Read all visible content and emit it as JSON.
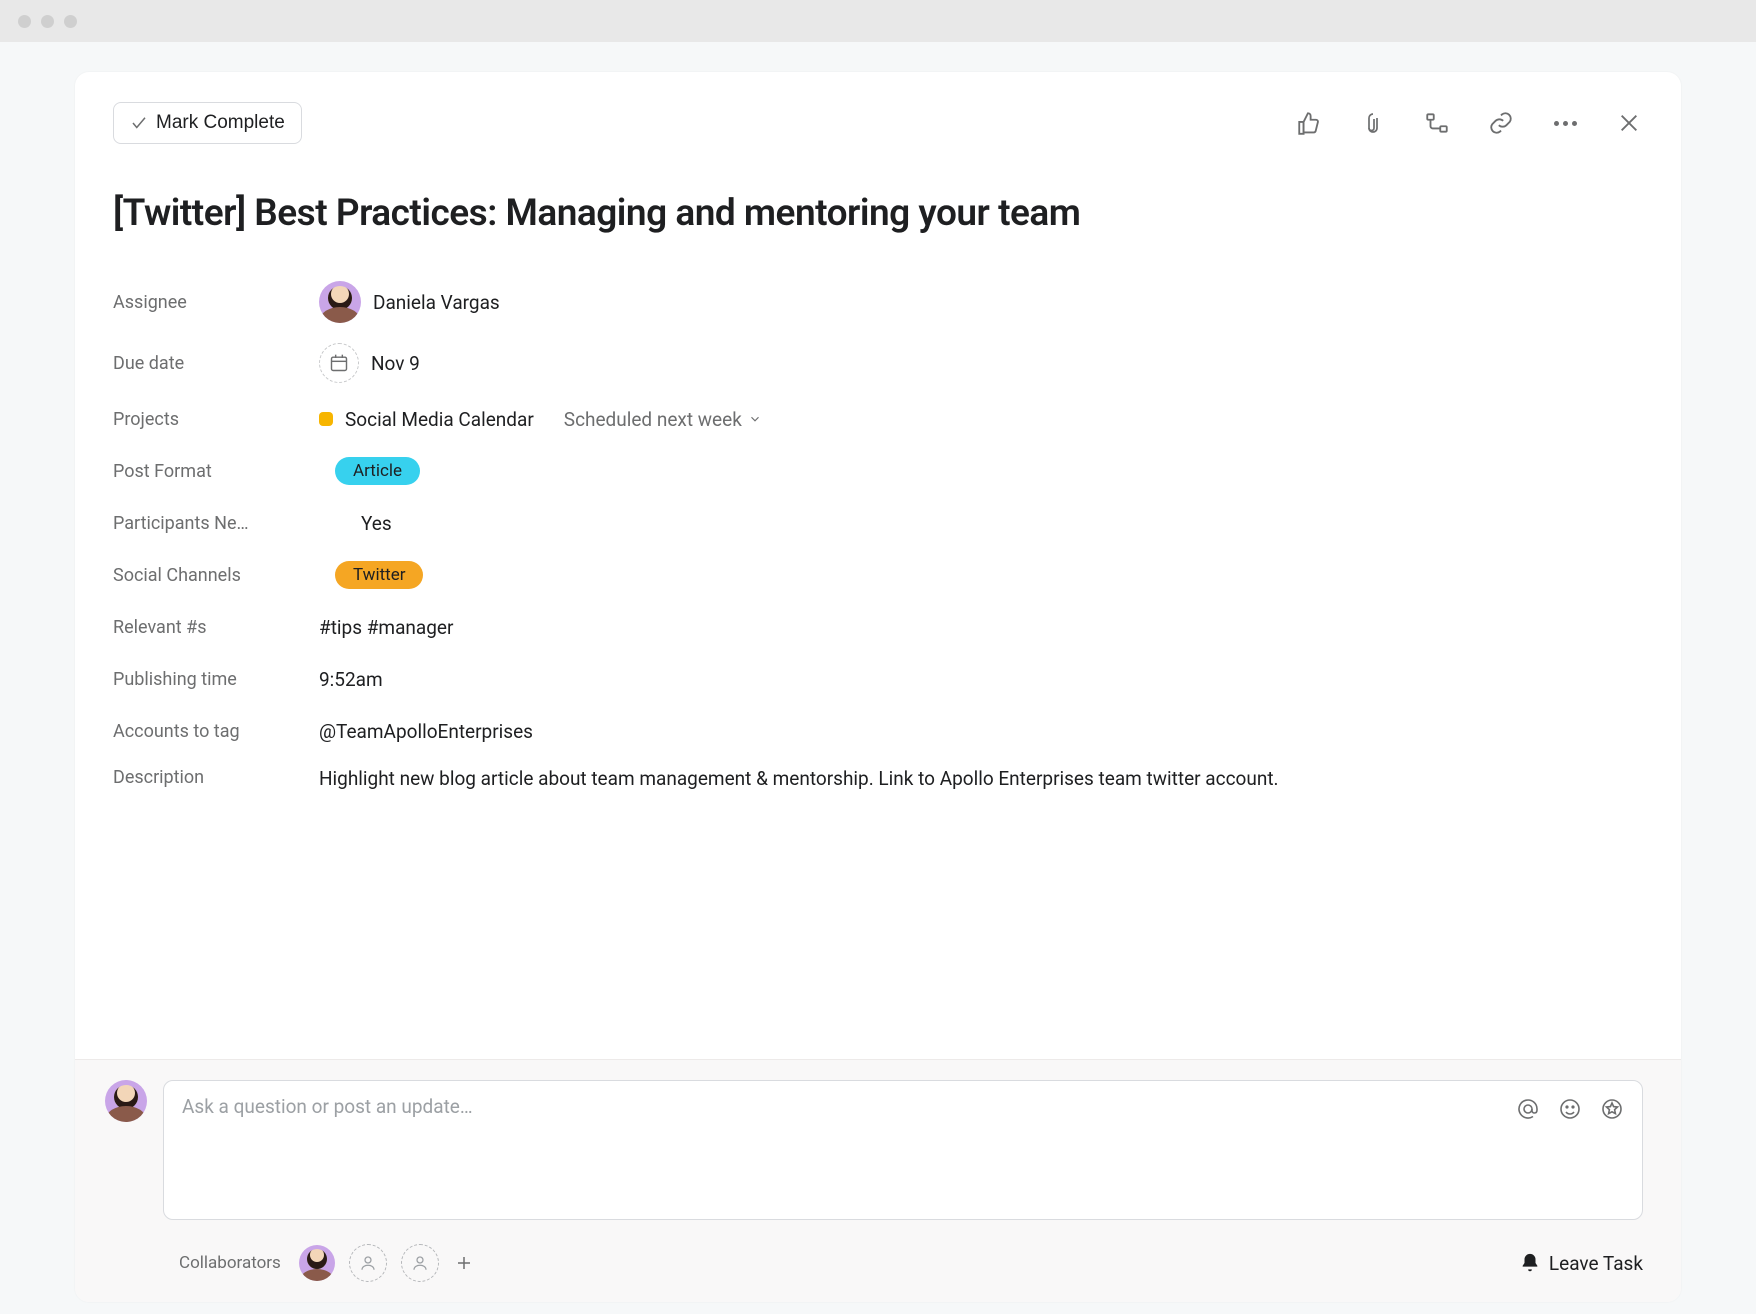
{
  "toolbar": {
    "mark_complete_label": "Mark Complete"
  },
  "task": {
    "title": "[Twitter] Best Practices: Managing and mentoring your team"
  },
  "fields": {
    "assignee": {
      "label": "Assignee",
      "value": "Daniela Vargas"
    },
    "due_date": {
      "label": "Due date",
      "value": "Nov 9"
    },
    "projects": {
      "label": "Projects",
      "name": "Social Media Calendar",
      "status": "Scheduled next week"
    },
    "post_format": {
      "label": "Post Format",
      "value": "Article"
    },
    "participants_needed": {
      "label": "Participants Ne…",
      "value": "Yes"
    },
    "social_channels": {
      "label": "Social Channels",
      "value": "Twitter"
    },
    "relevant_hashtags": {
      "label": "Relevant #s",
      "value": "#tips #manager"
    },
    "publishing_time": {
      "label": "Publishing time",
      "value": "9:52am"
    },
    "accounts_to_tag": {
      "label": "Accounts to tag",
      "value": "@TeamApolloEnterprises"
    },
    "description": {
      "label": "Description",
      "value": "Highlight new blog article about team management & mentorship. Link to Apollo Enterprises team twitter account."
    }
  },
  "comment": {
    "placeholder": "Ask a question or post an update…"
  },
  "collaborators": {
    "label": "Collaborators"
  },
  "leave_task_label": "Leave Task"
}
